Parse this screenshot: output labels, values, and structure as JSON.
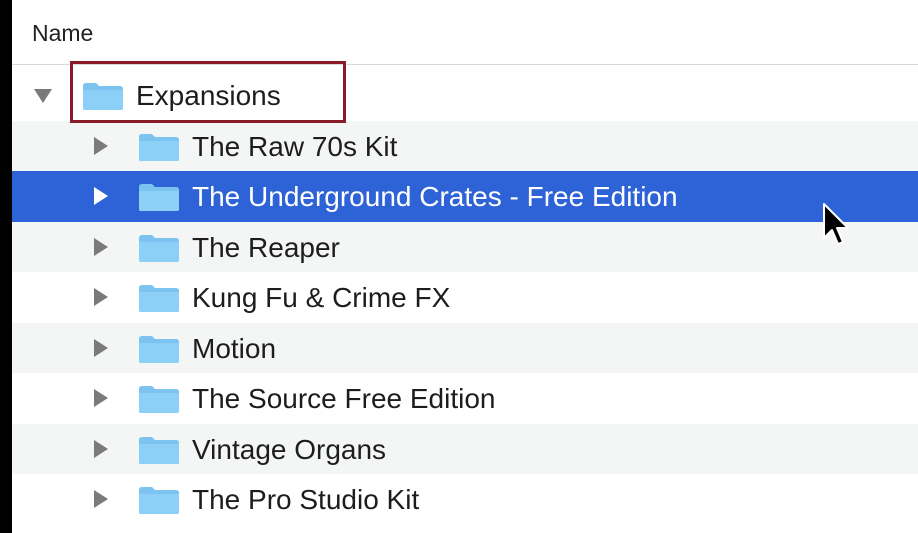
{
  "header": {
    "name_column": "Name"
  },
  "tree": {
    "root": {
      "label": "Expansions",
      "icon": "folder-icon",
      "expanded": true
    },
    "children": [
      {
        "label": "The Raw 70s Kit",
        "icon": "folder-icon"
      },
      {
        "label": "The Underground Crates - Free Edition",
        "icon": "folder-icon",
        "selected": true
      },
      {
        "label": "The Reaper",
        "icon": "folder-icon"
      },
      {
        "label": "Kung Fu & Crime FX",
        "icon": "folder-icon"
      },
      {
        "label": "Motion",
        "icon": "folder-icon"
      },
      {
        "label": "The Source Free Edition",
        "icon": "folder-icon"
      },
      {
        "label": "Vintage Organs",
        "icon": "folder-icon"
      },
      {
        "label": "The Pro Studio Kit",
        "icon": "folder-icon"
      }
    ]
  },
  "colors": {
    "selection": "#2e63d8",
    "folder": "#7cc3f0",
    "highlight_box": "#8b1a2b",
    "alt_row": "#f4f5f5"
  }
}
